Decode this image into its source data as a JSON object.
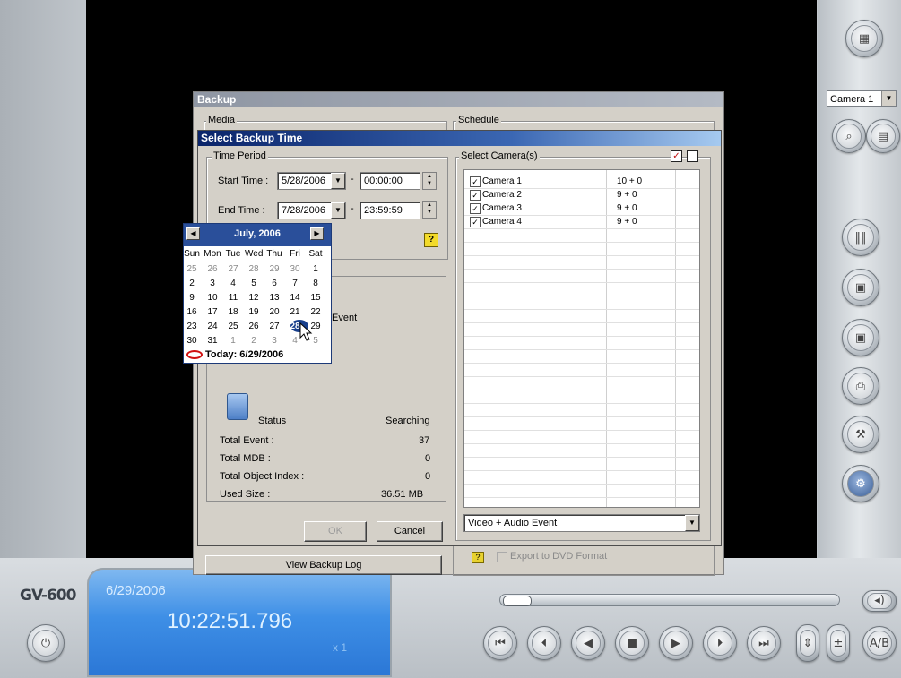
{
  "app": {
    "logo": "GV-600"
  },
  "right_panel": {
    "camera_select": "Camera 1"
  },
  "clock": {
    "date": "6/29/2006",
    "time": "10:22:51.796",
    "speed": "x 1"
  },
  "backup": {
    "title": "Backup",
    "media_label": "Media",
    "schedule_label": "Schedule",
    "view_log": "View Backup Log",
    "export_dvd": "Export to DVD Format"
  },
  "dialog": {
    "title": "Select Backup Time",
    "time_period_label": "Time Period",
    "start_label": "Start Time :",
    "start_date": "5/28/2006",
    "start_time": "00:00:00",
    "end_label": "End Time :",
    "end_date": "7/28/2006",
    "end_time": "23:59:59",
    "event_partial": "Event",
    "status": {
      "status_label": "Status",
      "status_value": "Searching",
      "total_event_label": "Total Event :",
      "total_event": "37",
      "total_mdb_label": "Total MDB :",
      "total_mdb": "0",
      "total_obj_label": "Total Object Index :",
      "total_obj": "0",
      "used_size_label": "Used Size :",
      "used_size": "36.51 MB"
    },
    "ok": "OK",
    "cancel": "Cancel",
    "select_cameras_label": "Select Camera(s)",
    "cameras": [
      {
        "name": "Camera 1",
        "value": "10 + 0",
        "checked": true
      },
      {
        "name": "Camera 2",
        "value": "9 + 0",
        "checked": true
      },
      {
        "name": "Camera 3",
        "value": "9 + 0",
        "checked": true
      },
      {
        "name": "Camera 4",
        "value": "9 + 0",
        "checked": true
      }
    ],
    "event_type": "Video + Audio Event"
  },
  "calendar": {
    "month": "July, 2006",
    "dow": [
      "Sun",
      "Mon",
      "Tue",
      "Wed",
      "Thu",
      "Fri",
      "Sat"
    ],
    "weeks": [
      [
        "25",
        "26",
        "27",
        "28",
        "29",
        "30",
        "1"
      ],
      [
        "2",
        "3",
        "4",
        "5",
        "6",
        "7",
        "8"
      ],
      [
        "9",
        "10",
        "11",
        "12",
        "13",
        "14",
        "15"
      ],
      [
        "16",
        "17",
        "18",
        "19",
        "20",
        "21",
        "22"
      ],
      [
        "23",
        "24",
        "25",
        "26",
        "27",
        "28",
        "29"
      ],
      [
        "30",
        "31",
        "1",
        "2",
        "3",
        "4",
        "5"
      ]
    ],
    "selected": "28",
    "today": "Today: 6/29/2006"
  }
}
